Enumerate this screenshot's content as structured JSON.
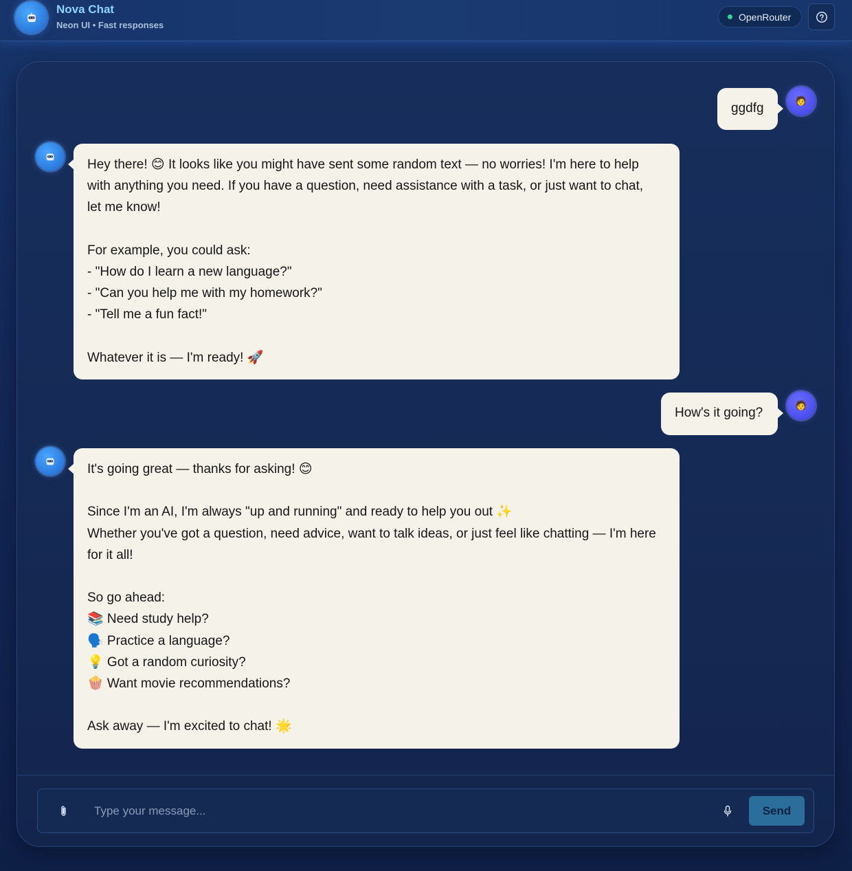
{
  "header": {
    "title": "Nova Chat",
    "subtitle": "Neon UI • Fast responses",
    "provider": "OpenRouter",
    "provider_status_color": "#34d399",
    "help_icon": "help-circle-icon",
    "logo_icon": "robot-icon"
  },
  "messages": [
    {
      "role": "user",
      "avatar_icon": "user-face-icon",
      "lines": [
        "ggdfg"
      ]
    },
    {
      "role": "assistant",
      "avatar_icon": "robot-icon",
      "lines": [
        "Hey there! 😊 It looks like you might have sent some random text — no worries! I'm here to help",
        "with anything you need. If you have a question, need assistance with a task, or just want to chat,",
        "let me know!",
        "",
        "For example, you could ask:",
        "- \"How do I learn a new language?\"",
        "- \"Can you help me with my homework?\"",
        "- \"Tell me a fun fact!\"",
        "",
        "Whatever it is — I'm ready! 🚀"
      ]
    },
    {
      "role": "user",
      "avatar_icon": "user-face-icon",
      "lines": [
        "How's it going?"
      ]
    },
    {
      "role": "assistant",
      "avatar_icon": "robot-icon",
      "lines": [
        "It's going great — thanks for asking! 😊",
        "",
        "Since I'm an AI, I'm always \"up and running\" and ready to help you out ✨",
        "Whether you've got a question, need advice, want to talk ideas, or just feel like chatting — I'm here",
        "for it all!",
        "",
        "So go ahead:",
        "📚 Need study help?",
        "🗣️ Practice a language?",
        "💡 Got a random curiosity?",
        "🍿 Want movie recommendations?",
        "",
        "Ask away — I'm excited to chat! 🌟"
      ]
    }
  ],
  "composer": {
    "placeholder": "Type your message...",
    "value": "",
    "attach_icon": "paperclip-icon",
    "mic_icon": "microphone-icon",
    "send_label": "Send"
  },
  "colors": {
    "bubble": "#f5f2ea",
    "accent": "#8fd4ff",
    "send": "#2b6e9c"
  }
}
